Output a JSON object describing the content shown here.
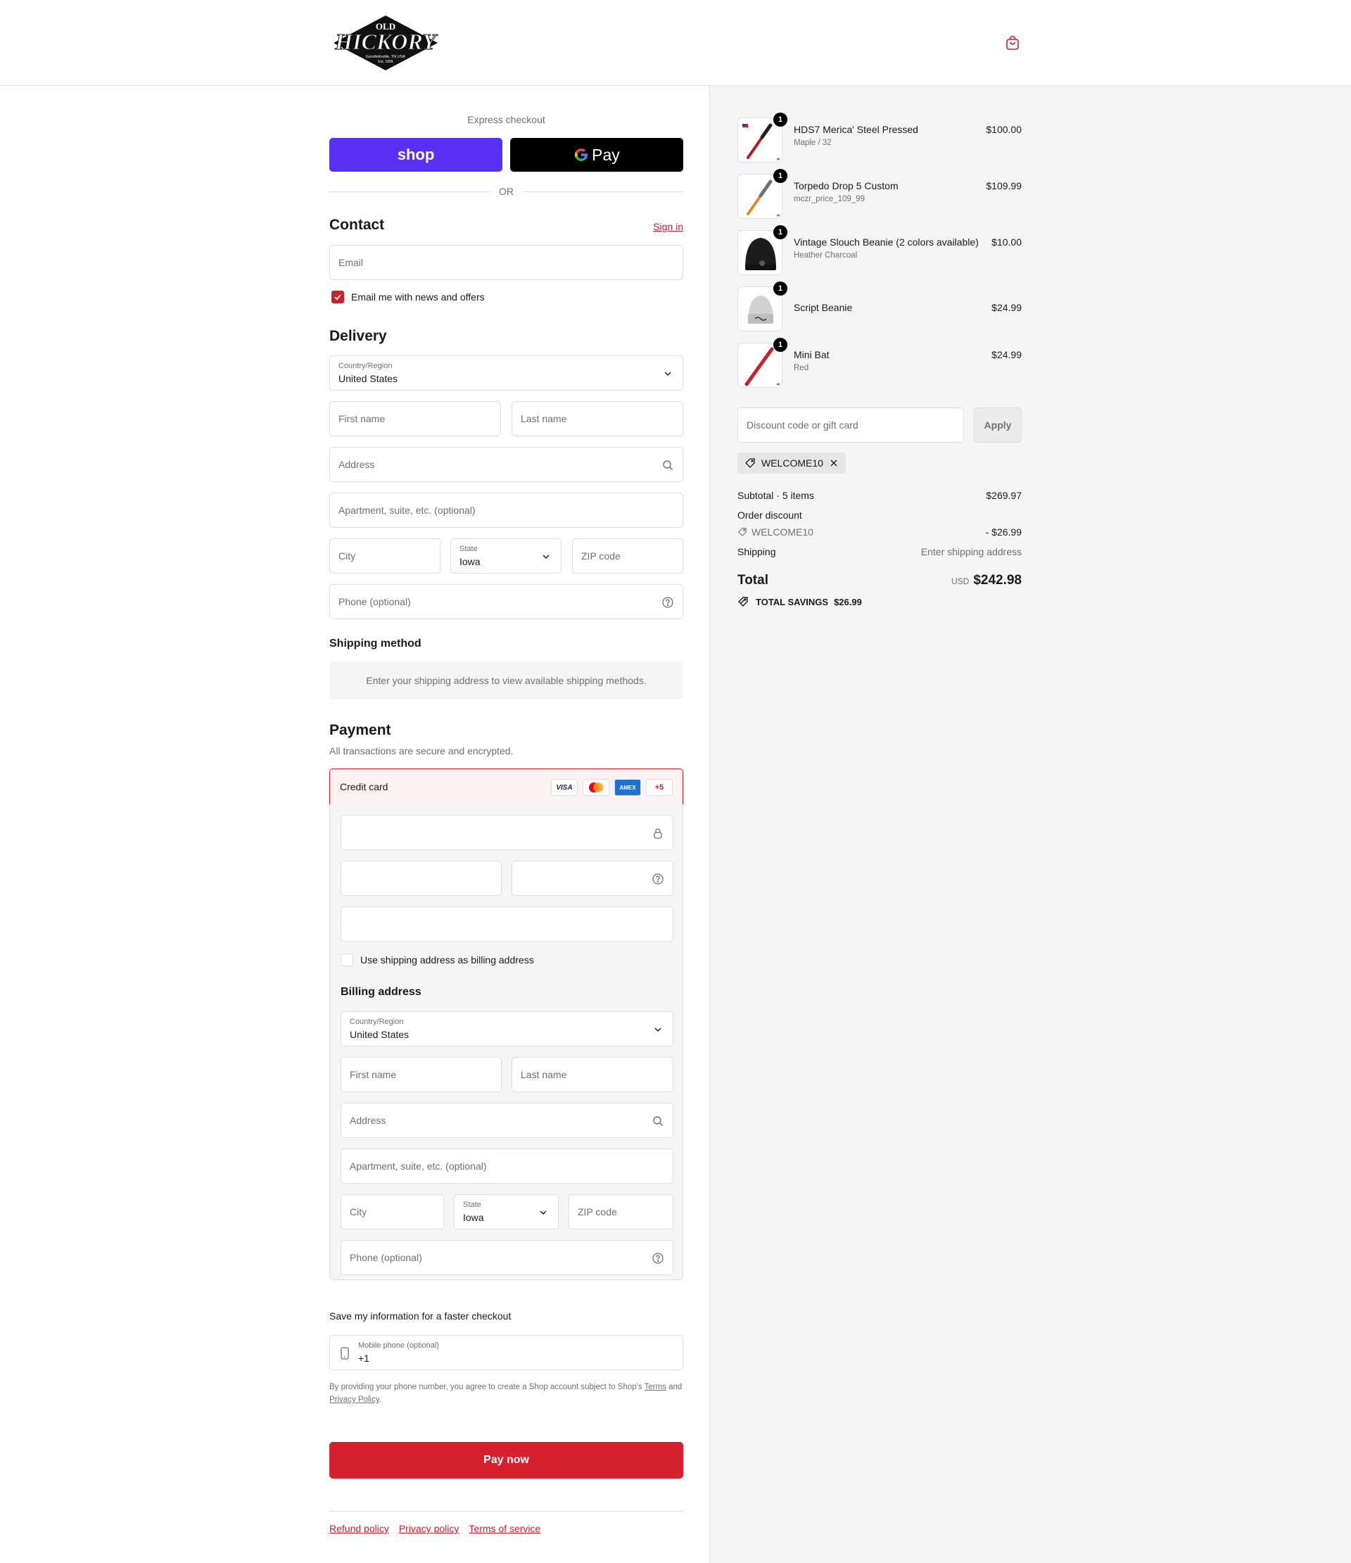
{
  "header": {
    "logo_top": "OLD",
    "logo_main": "HICKORY",
    "logo_sub": "Goodlettsville, TN USA",
    "logo_est": "Est. 1899",
    "cart_icon": "shopping-bag-icon"
  },
  "express": {
    "label": "Express checkout",
    "shop_label": "shop",
    "gpay_label": "Pay",
    "or_label": "OR"
  },
  "contact": {
    "title": "Contact",
    "sign_in": "Sign in",
    "email_placeholder": "Email",
    "news_label": "Email me with news and offers",
    "news_checked": true
  },
  "delivery": {
    "title": "Delivery",
    "country_label": "Country/Region",
    "country_value": "United States",
    "first_name_placeholder": "First name",
    "last_name_placeholder": "Last name",
    "address_placeholder": "Address",
    "apartment_placeholder": "Apartment, suite, etc. (optional)",
    "city_placeholder": "City",
    "state_label": "State",
    "state_value": "Iowa",
    "zip_placeholder": "ZIP code",
    "phone_placeholder": "Phone (optional)"
  },
  "shipping_method": {
    "title": "Shipping method",
    "note": "Enter your shipping address to view available shipping methods."
  },
  "payment": {
    "title": "Payment",
    "subtitle": "All transactions are secure and encrypted.",
    "credit_card_label": "Credit card",
    "card_brands": [
      "VISA",
      "mastercard",
      "AMEX"
    ],
    "more_cards": "+5",
    "billing_same_label": "Use shipping address as billing address",
    "billing_same_checked": false
  },
  "billing": {
    "title": "Billing address",
    "country_label": "Country/Region",
    "country_value": "United States",
    "first_name_placeholder": "First name",
    "last_name_placeholder": "Last name",
    "address_placeholder": "Address",
    "apartment_placeholder": "Apartment, suite, etc. (optional)",
    "city_placeholder": "City",
    "state_label": "State",
    "state_value": "Iowa",
    "zip_placeholder": "ZIP code",
    "phone_placeholder": "Phone (optional)"
  },
  "save_info": {
    "title": "Save my information for a faster checkout",
    "mobile_label": "Mobile phone (optional)",
    "mobile_value": "+1",
    "legal_prefix": "By providing your phone number, you agree to create a Shop account subject to Shop's",
    "terms_link": "Terms",
    "legal_and": "and",
    "privacy_link": "Privacy Policy",
    "legal_end": "."
  },
  "pay_button": "Pay now",
  "footer": {
    "refund": "Refund policy",
    "privacy": "Privacy policy",
    "terms": "Terms of service"
  },
  "summary": {
    "items": [
      {
        "name": "HDS7 Merica' Steel Pressed",
        "variant": "Maple / 32",
        "price": "$100.00",
        "qty": "1"
      },
      {
        "name": "Torpedo Drop 5 Custom",
        "variant": "mczr_price_109_99",
        "price": "$109.99",
        "qty": "1"
      },
      {
        "name": "Vintage Slouch Beanie (2 colors available)",
        "variant": "Heather Charcoal",
        "price": "$10.00",
        "qty": "1"
      },
      {
        "name": "Script Beanie",
        "variant": "",
        "price": "$24.99",
        "qty": "1"
      },
      {
        "name": "Mini Bat",
        "variant": "Red",
        "price": "$24.99",
        "qty": "1"
      }
    ],
    "discount_placeholder": "Discount code or gift card",
    "apply_label": "Apply",
    "applied_code": "WELCOME10",
    "subtotal_label": "Subtotal · 5 items",
    "subtotal_value": "$269.97",
    "order_discount_label": "Order discount",
    "discount_code": "WELCOME10",
    "discount_value": "- $26.99",
    "shipping_label": "Shipping",
    "shipping_value": "Enter shipping address",
    "total_label": "Total",
    "currency": "USD",
    "total_value": "$242.98",
    "savings_label": "TOTAL SAVINGS",
    "savings_value": "$26.99"
  },
  "colors": {
    "accent": "#c8202e",
    "pay_button": "#d5202e",
    "shop_pay": "#5a31f4",
    "summary_bg": "#f5f5f5"
  }
}
